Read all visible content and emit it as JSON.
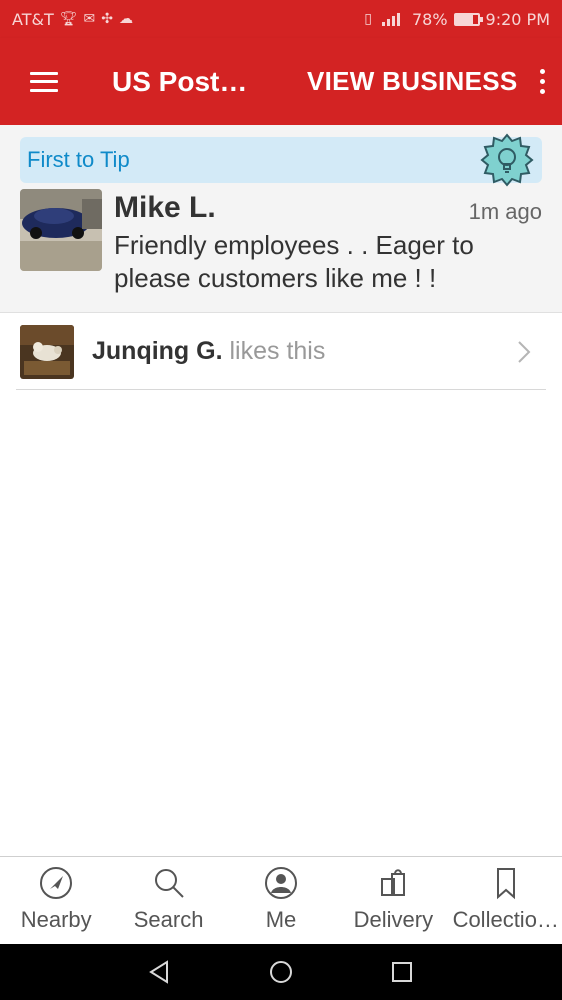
{
  "status_bar": {
    "carrier": "AT&T",
    "battery_percent": "78%",
    "battery_level": 0.78,
    "time": "9:20 PM"
  },
  "app_bar": {
    "title": "US Post…",
    "action": "VIEW BUSINESS",
    "menu_icon": "hamburger-menu-icon",
    "overflow_icon": "more-vert-icon"
  },
  "tip": {
    "banner_label": "First to Tip",
    "badge_icon": "lightbulb-badge-icon",
    "reviewer_name": "Mike L.",
    "timestamp": "1m ago",
    "text": "Friendly employees . . Eager to please customers like me ! !"
  },
  "likes": {
    "name": "Junqing G.",
    "suffix": " likes this"
  },
  "bottom_nav": {
    "items": [
      {
        "label": "Nearby",
        "icon": "compass-icon"
      },
      {
        "label": "Search",
        "icon": "search-icon"
      },
      {
        "label": "Me",
        "icon": "profile-icon"
      },
      {
        "label": "Delivery",
        "icon": "delivery-bag-icon"
      },
      {
        "label": "Collectio…",
        "icon": "bookmark-icon"
      }
    ]
  },
  "colors": {
    "brand_red": "#d32323",
    "banner_blue": "#d3eaf7",
    "banner_text": "#0f8ac9",
    "badge_teal": "#7fd1cf"
  }
}
